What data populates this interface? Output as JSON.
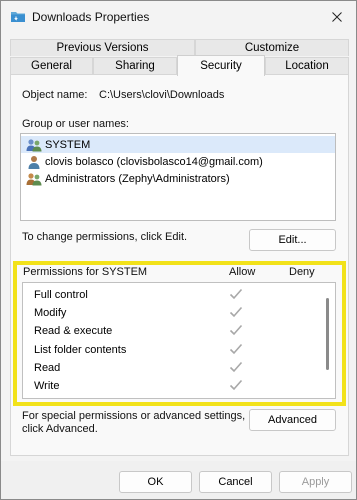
{
  "window": {
    "title": "Downloads Properties"
  },
  "tabs": {
    "row1": [
      {
        "label": "Previous Versions"
      },
      {
        "label": "Customize"
      }
    ],
    "row2": [
      {
        "label": "General"
      },
      {
        "label": "Sharing"
      },
      {
        "label": "Security",
        "active": true
      },
      {
        "label": "Location"
      }
    ]
  },
  "security": {
    "object_name_label": "Object name:",
    "object_name_value": "C:\\Users\\clovi\\Downloads",
    "group_label": "Group or user names:",
    "users": [
      {
        "name": "SYSTEM",
        "icon": "users-group-icon",
        "selected": true
      },
      {
        "name": "clovis bolasco (clovisbolasco14@gmail.com)",
        "icon": "user-icon"
      },
      {
        "name": "Administrators (Zephy\\Administrators)",
        "icon": "users-group-icon"
      }
    ],
    "change_hint": "To change permissions, click Edit.",
    "edit_button": "Edit...",
    "permissions_for": "Permissions for SYSTEM",
    "col_allow": "Allow",
    "col_deny": "Deny",
    "permissions": [
      {
        "name": "Full control",
        "allow": true,
        "deny": false
      },
      {
        "name": "Modify",
        "allow": true,
        "deny": false
      },
      {
        "name": "Read & execute",
        "allow": true,
        "deny": false
      },
      {
        "name": "List folder contents",
        "allow": true,
        "deny": false
      },
      {
        "name": "Read",
        "allow": true,
        "deny": false
      },
      {
        "name": "Write",
        "allow": true,
        "deny": false
      }
    ],
    "special_hint_line1": "For special permissions or advanced settings,",
    "special_hint_line2": "click Advanced.",
    "advanced_button": "Advanced"
  },
  "footer": {
    "ok": "OK",
    "cancel": "Cancel",
    "apply": "Apply"
  },
  "colors": {
    "highlight": "#f2e21a",
    "selection": "#dbe9fa",
    "check": "#a8a8a8"
  }
}
